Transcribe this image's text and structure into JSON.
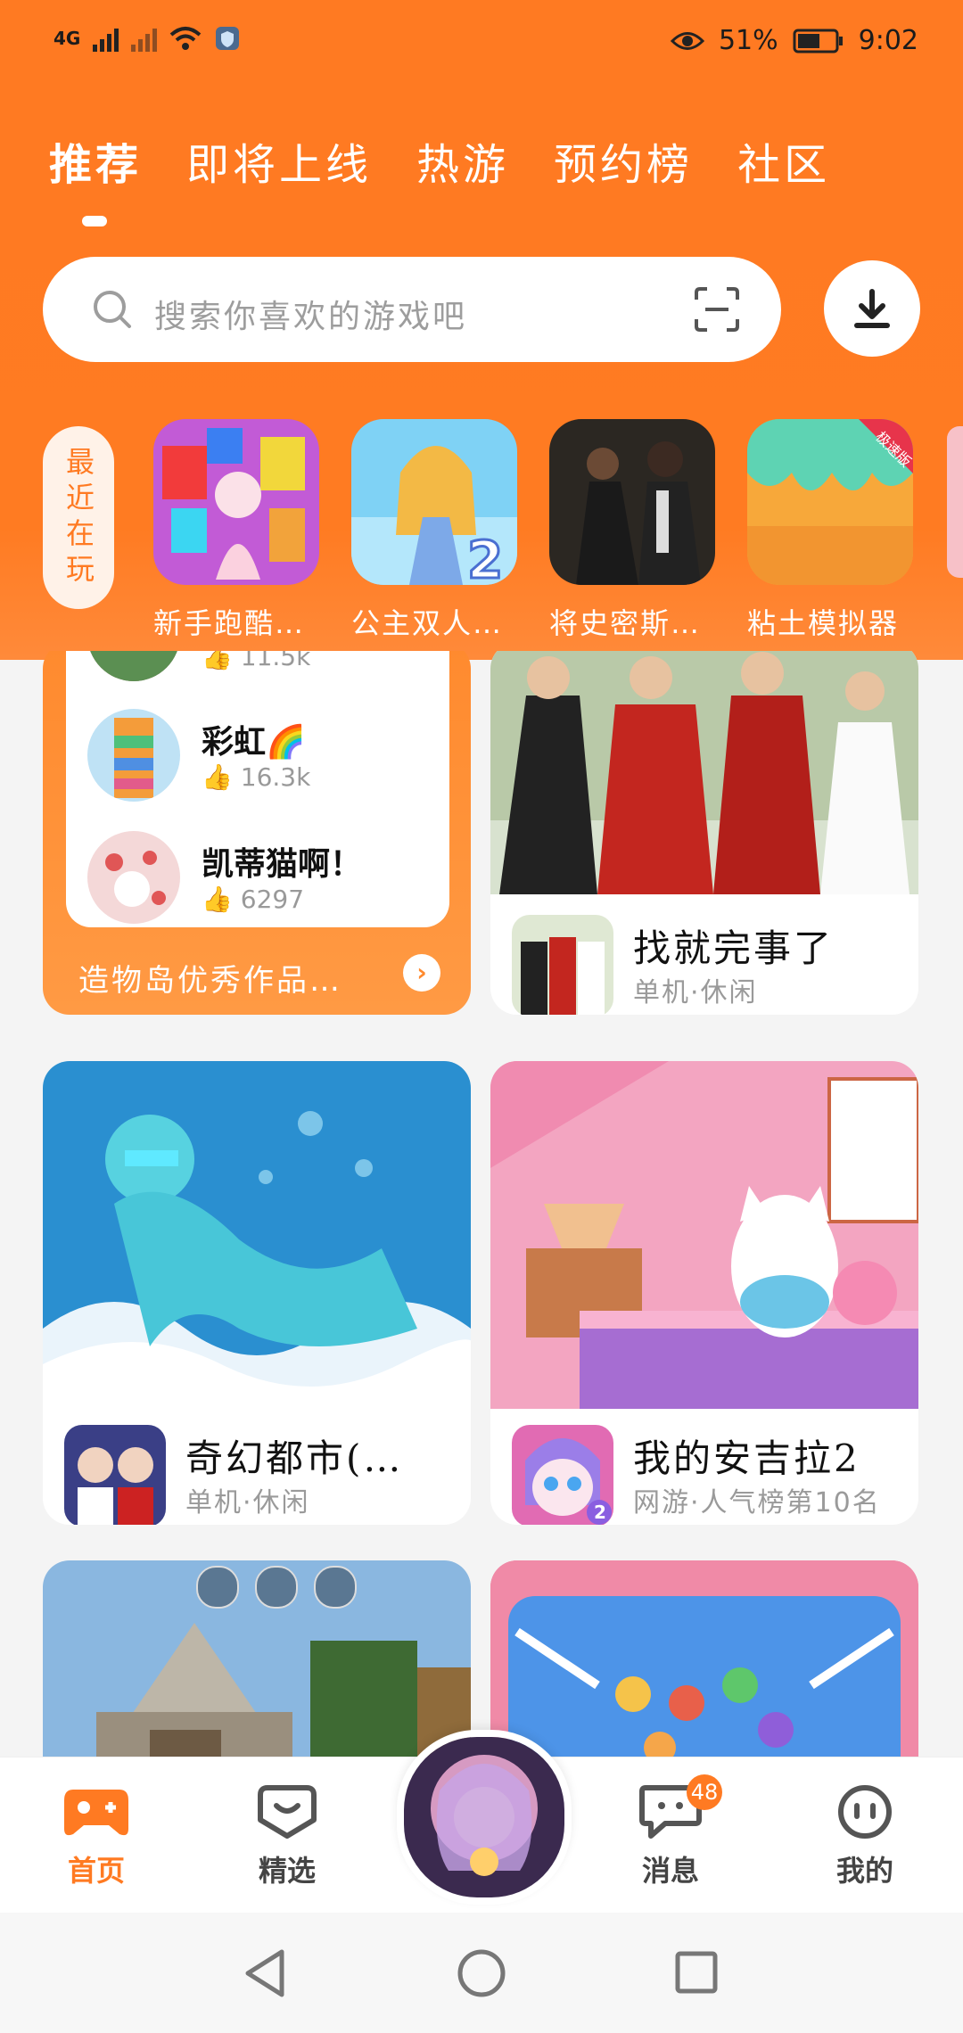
{
  "status_bar": {
    "network": "4G",
    "battery": "51%",
    "time": "9:02"
  },
  "tabs": [
    {
      "label": "推荐",
      "active": true
    },
    {
      "label": "即将上线",
      "active": false
    },
    {
      "label": "热游",
      "active": false
    },
    {
      "label": "预约榜",
      "active": false
    },
    {
      "label": "社区",
      "active": false
    }
  ],
  "search": {
    "placeholder": "搜索你喜欢的游戏吧"
  },
  "recent": {
    "label": "最近在玩",
    "items": [
      {
        "name": "新手跑酷…"
      },
      {
        "name": "公主双人…"
      },
      {
        "name": "将史密斯…"
      },
      {
        "name": "粘土模拟器",
        "badge": "极速版"
      }
    ]
  },
  "collection_card": {
    "items": [
      {
        "name": "",
        "likes": "11.5k"
      },
      {
        "name": "彩虹🌈",
        "likes": "16.3k"
      },
      {
        "name": "凯蒂猫啊！",
        "likes": "6297"
      }
    ],
    "footer": "造物岛优秀作品…"
  },
  "cards": [
    {
      "title": "找就完事了",
      "sub": "单机·休闲"
    },
    {
      "title": "奇幻都市(…",
      "sub": "单机·休闲"
    },
    {
      "title": "我的安吉拉2",
      "sub": "网游·人气榜第10名"
    }
  ],
  "bottom_nav": [
    {
      "label": "首页",
      "icon": "gamepad-icon",
      "active": true
    },
    {
      "label": "精选",
      "icon": "heart-icon",
      "active": false
    },
    {
      "label": "",
      "icon": "avatar",
      "active": false
    },
    {
      "label": "消息",
      "icon": "chat-icon",
      "active": false,
      "badge": "48"
    },
    {
      "label": "我的",
      "icon": "face-icon",
      "active": false
    }
  ],
  "colors": {
    "brand": "#ff7a22",
    "text": "#111111",
    "muted": "#9a9a9a"
  }
}
